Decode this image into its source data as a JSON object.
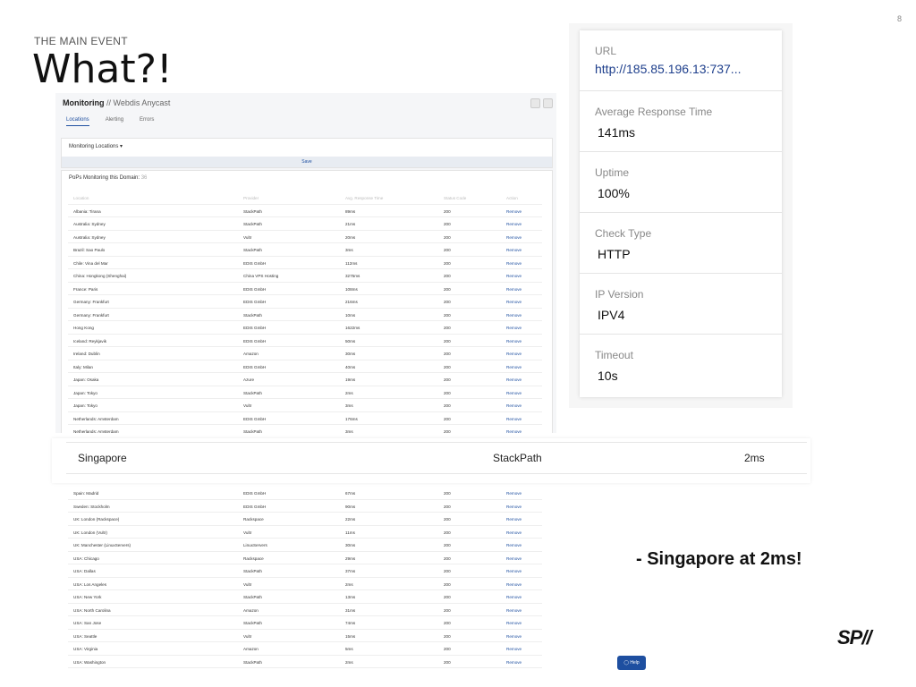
{
  "slide": {
    "page_number": "8",
    "eyebrow": "THE MAIN EVENT",
    "title": "What?!",
    "callout": "- Singapore at 2ms!",
    "logo": "SP//"
  },
  "monitoring": {
    "heading": "Monitoring",
    "subheading": "// Webdis Anycast",
    "tabs": [
      "Locations",
      "Alerting",
      "Errors"
    ],
    "locations_label": "Monitoring Locations",
    "save_label": "Save",
    "pops_label": "PoPs Monitoring this Domain",
    "pops_count": "36",
    "columns": [
      "Location",
      "Provider",
      "Avg. Response Time",
      "Status Code",
      "Action"
    ],
    "rows_top": [
      [
        "Albania: Tirana",
        "StackPath",
        "89ms",
        "200",
        "Remove"
      ],
      [
        "Australia: Sydney",
        "StackPath",
        "21ms",
        "200",
        "Remove"
      ],
      [
        "Australia: Sydney",
        "Vultr",
        "20ms",
        "200",
        "Remove"
      ],
      [
        "Brazil: Sao Paulo",
        "StackPath",
        "3ms",
        "200",
        "Remove"
      ],
      [
        "Chile: Vina del Mar",
        "EDIS GmbH",
        "112ms",
        "200",
        "Remove"
      ],
      [
        "China: Hongkong (Shenghai)",
        "China VPS Hosting",
        "3275ms",
        "200",
        "Remove"
      ],
      [
        "France: Paris",
        "EDIS GmbH",
        "108ms",
        "200",
        "Remove"
      ],
      [
        "Germany: Frankfurt",
        "EDIS GmbH",
        "216ms",
        "200",
        "Remove"
      ],
      [
        "Germany: Frankfurt",
        "StackPath",
        "10ms",
        "200",
        "Remove"
      ],
      [
        "Hong Kong",
        "EDIS GmbH",
        "1622ms",
        "200",
        "Remove"
      ],
      [
        "Iceland: Reykjavik",
        "EDIS GmbH",
        "50ms",
        "200",
        "Remove"
      ],
      [
        "Ireland: Dublin",
        "Amazon",
        "30ms",
        "200",
        "Remove"
      ],
      [
        "Italy: Milan",
        "EDIS GmbH",
        "40ms",
        "200",
        "Remove"
      ],
      [
        "Japan: Osaka",
        "Azure",
        "19ms",
        "200",
        "Remove"
      ],
      [
        "Japan: Tokyo",
        "StackPath",
        "2ms",
        "200",
        "Remove"
      ],
      [
        "Japan: Tokyo",
        "Vultr",
        "3ms",
        "200",
        "Remove"
      ],
      [
        "Netherlands: Amsterdam",
        "EDIS GmbH",
        "176ms",
        "200",
        "Remove"
      ],
      [
        "Netherlands: Amsterdam",
        "StackPath",
        "3ms",
        "200",
        "Remove"
      ]
    ],
    "rows_bottom": [
      [
        "Spain: Madrid",
        "EDIS GmbH",
        "67ms",
        "200",
        "Remove"
      ],
      [
        "Sweden: Stockholm",
        "EDIS GmbH",
        "90ms",
        "200",
        "Remove"
      ],
      [
        "UK: London (Rackspace)",
        "Rackspace",
        "22ms",
        "200",
        "Remove"
      ],
      [
        "UK: London (Vultr)",
        "Vultr",
        "11ms",
        "200",
        "Remove"
      ],
      [
        "UK: Manchester (LinuxServers)",
        "LinuxServers",
        "30ms",
        "200",
        "Remove"
      ],
      [
        "USA: Chicago",
        "Rackspace",
        "29ms",
        "200",
        "Remove"
      ],
      [
        "USA: Dallas",
        "StackPath",
        "37ms",
        "200",
        "Remove"
      ],
      [
        "USA: Los Angeles",
        "Vultr",
        "2ms",
        "200",
        "Remove"
      ],
      [
        "USA: New York",
        "StackPath",
        "13ms",
        "200",
        "Remove"
      ],
      [
        "USA: North Carolina",
        "Amazon",
        "31ms",
        "200",
        "Remove"
      ],
      [
        "USA: San Jose",
        "StackPath",
        "74ms",
        "200",
        "Remove"
      ],
      [
        "USA: Seattle",
        "Vultr",
        "15ms",
        "200",
        "Remove"
      ],
      [
        "USA: Virginia",
        "Amazon",
        "5ms",
        "200",
        "Remove"
      ],
      [
        "USA: Washington",
        "StackPath",
        "2ms",
        "200",
        "Remove"
      ]
    ],
    "help_label": "Help"
  },
  "highlight_row": {
    "location": "Singapore",
    "provider": "StackPath",
    "time": "2ms"
  },
  "detail": {
    "fields": [
      {
        "label": "URL",
        "value": "http://185.85.196.13:737..."
      },
      {
        "label": "Average Response Time",
        "value": "141ms"
      },
      {
        "label": "Uptime",
        "value": "100%"
      },
      {
        "label": "Check Type",
        "value": "HTTP"
      },
      {
        "label": "IP Version",
        "value": "IPV4"
      },
      {
        "label": "Timeout",
        "value": "10s"
      }
    ]
  }
}
